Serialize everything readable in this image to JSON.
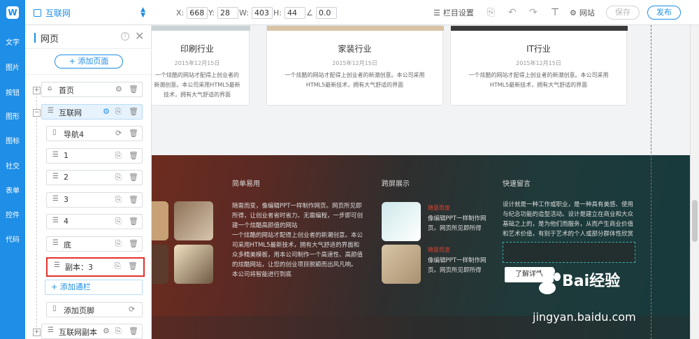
{
  "toolbar": {
    "site_name": "互联网",
    "x_label": "X:",
    "x_value": "668",
    "y_label": "Y:",
    "y_value": "28",
    "w_label": "W:",
    "w_value": "403",
    "h_label": "H:",
    "h_value": "44",
    "rotate_value": "0.0",
    "column_settings": "栏目设置",
    "website": "网站",
    "save": "保存",
    "publish": "发布"
  },
  "leftnav": [
    "文字",
    "图片",
    "按钮",
    "图形",
    "图标",
    "社交",
    "表单",
    "控件",
    "代码"
  ],
  "panel": {
    "title": "网页",
    "add_page": "添加页面",
    "nodes": [
      {
        "label": "首页"
      },
      {
        "label": "互联网"
      },
      {
        "label": "导航4"
      },
      {
        "label": "1"
      },
      {
        "label": "2"
      },
      {
        "label": "3"
      },
      {
        "label": "4"
      },
      {
        "label": "底"
      },
      {
        "label": "副本：3"
      },
      {
        "label": "添加页脚"
      },
      {
        "label": "互联网副本"
      }
    ],
    "add_channel": "+ 添加通栏"
  },
  "cards": [
    {
      "title": "印刷行业",
      "date": "2015年12月15日",
      "desc": "一个炫酷的网站才配得上创业者的新潮创意。本公司采用HTML5最新技术，拥有大气舒适的界面"
    },
    {
      "title": "家装行业",
      "date": "2015年12月15日",
      "desc": "一个炫酷的网站才配得上创业者的新潮创意。本公司采用HTML5最新技术，拥有大气舒适的界面"
    },
    {
      "title": "IT行业",
      "date": "2015年12月15日",
      "desc": "一个炫酷的网站才配得上创业者的新潮创意。本公司采用HTML5最新技术，拥有大气舒适的界面"
    }
  ],
  "footer": {
    "col1_title": "简单易用",
    "col1_text": "随需而变，像编辑PPT一样制作网页。网页所见即所得，让创业者省时省力。无需编程，一步即可创建一个炫酷高颜值的网站\n一个炫酷的网站才配得上创业者的新潮创意。本公司采用HTML5最新技术，拥有大气舒适的界面和众多精美模板，用本公司制作一个高速性、高颜值的炫酷网站，让您的创业项目脱颖而出风凡响。\n本公司将智能进行到底",
    "col2_title": "跨屏展示",
    "col2_tag": "随意而变",
    "col2_text": "像编辑PPT一样制作网页。网页所见即所得",
    "col3_title": "快速留言",
    "col3_text": "设计就是一种工作或职业，是一种具有美感、使用与纪念功能的造型活动。设计是建立在商业和大众基础之上的，是为他们而服务，从而产生商业价值和艺术价值，有别于艺术的个人或部分群体性欣赏",
    "learn_more": "了解详情"
  },
  "watermark": {
    "brand": "Bai经验",
    "url": "jingyan.baidu.com"
  },
  "colors": {
    "accent": "#1e8ee6",
    "highlight": "#e2322d"
  }
}
